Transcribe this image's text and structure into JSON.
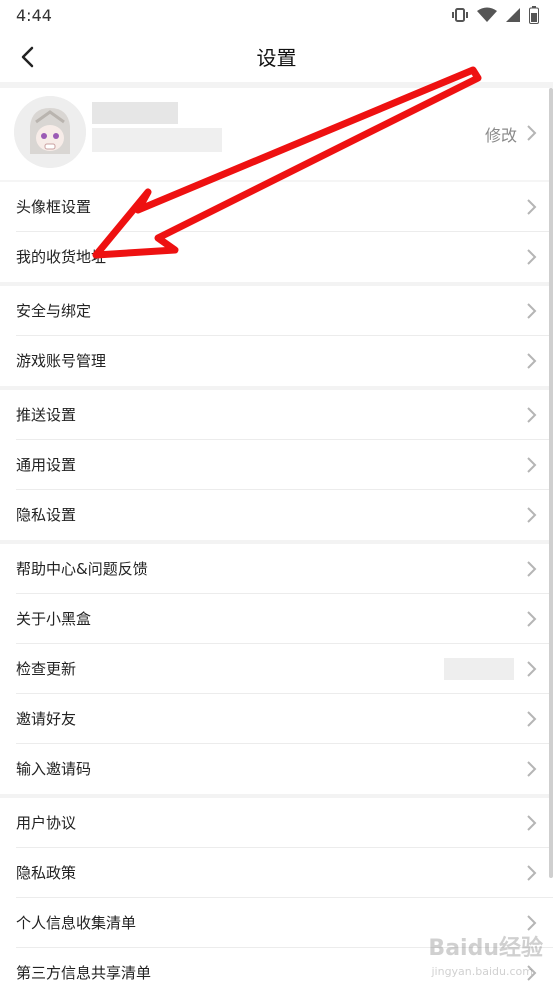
{
  "status_bar": {
    "time": "4:44"
  },
  "header": {
    "title": "设置"
  },
  "profile": {
    "edit_label": "修改"
  },
  "groups": [
    {
      "items": [
        "头像框设置",
        "我的收货地址"
      ]
    },
    {
      "items": [
        "安全与绑定",
        "游戏账号管理"
      ]
    },
    {
      "items": [
        "推送设置",
        "通用设置",
        "隐私设置"
      ]
    },
    {
      "items": [
        "帮助中心&问题反馈",
        "关于小黑盒",
        "检查更新",
        "邀请好友",
        "输入邀请码"
      ]
    },
    {
      "items": [
        "用户协议",
        "隐私政策",
        "个人信息收集清单",
        "第三方信息共享清单"
      ]
    }
  ],
  "watermark": {
    "main": "Baidu经验",
    "sub": "jingyan.baidu.com"
  },
  "colors": {
    "annotation_arrow": "#ee1111",
    "chevron": "#b5b5b5",
    "divider": "#ececec"
  }
}
